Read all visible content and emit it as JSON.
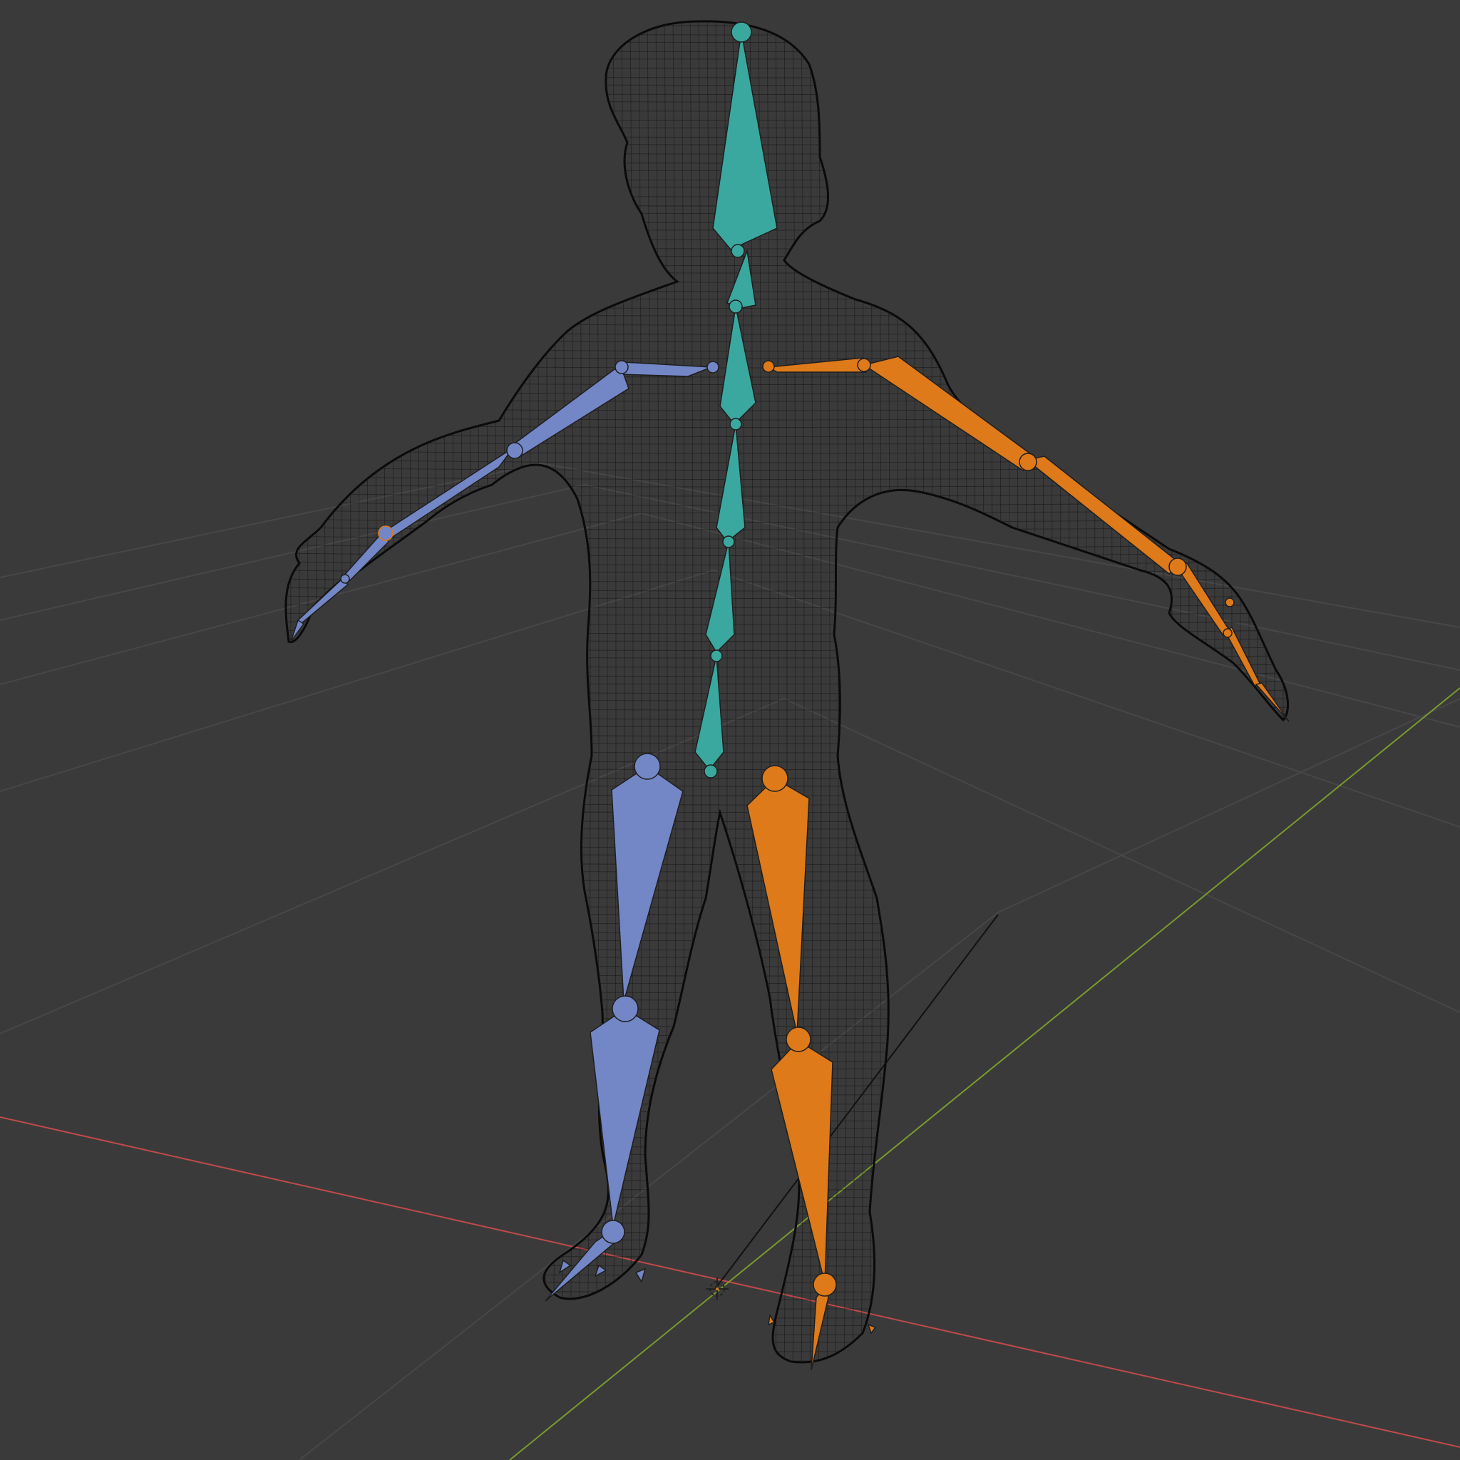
{
  "viewport": {
    "background": "#3a3a3a",
    "grid_color": "#474747",
    "x_axis_color": "#c0494b",
    "y_axis_color": "#7a9a2e",
    "display_mode": "wireframe"
  },
  "armature": {
    "colors": {
      "center": "#3aa89f",
      "left": "#7386c6",
      "right": "#de7a1a",
      "outline": "#1e1e1e"
    },
    "bone_groups": [
      "center-spine-head",
      "left-arm",
      "right-arm",
      "left-leg",
      "right-leg"
    ]
  },
  "icons": {
    "origin": "3d-cursor-icon"
  }
}
